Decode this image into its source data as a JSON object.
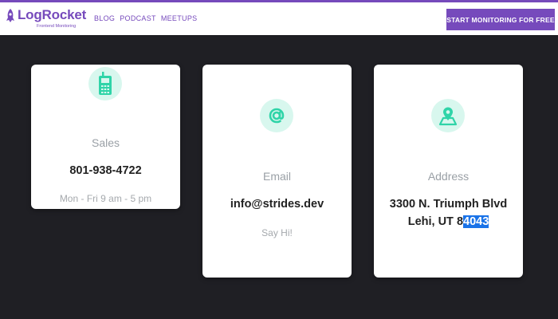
{
  "header": {
    "logo": {
      "name": "LogRocket",
      "tagline": "Frontend Monitoring"
    },
    "nav": [
      "BLOG",
      "PODCAST",
      "MEETUPS"
    ],
    "cta_label": "START MONITORING FOR FREE"
  },
  "cards": {
    "sales": {
      "icon": "mobile-phone-icon",
      "label": "Sales",
      "value": "801-938-4722",
      "note": "Mon - Fri 9 am - 5 pm"
    },
    "email": {
      "icon": "at-sign-icon",
      "label": "Email",
      "value": "info@strides.dev",
      "note": "Say Hi!"
    },
    "address": {
      "icon": "map-pin-icon",
      "label": "Address",
      "line1": "3300 N. Triumph Blvd",
      "line2_plain": "Lehi, UT 8",
      "line2_selected": "4043"
    }
  },
  "colors": {
    "brand": "#764abc",
    "background": "#1f1f24",
    "icon_teal": "#2fd4a8",
    "icon_circle": "#d8f7ee",
    "selection": "#1a73e8"
  }
}
